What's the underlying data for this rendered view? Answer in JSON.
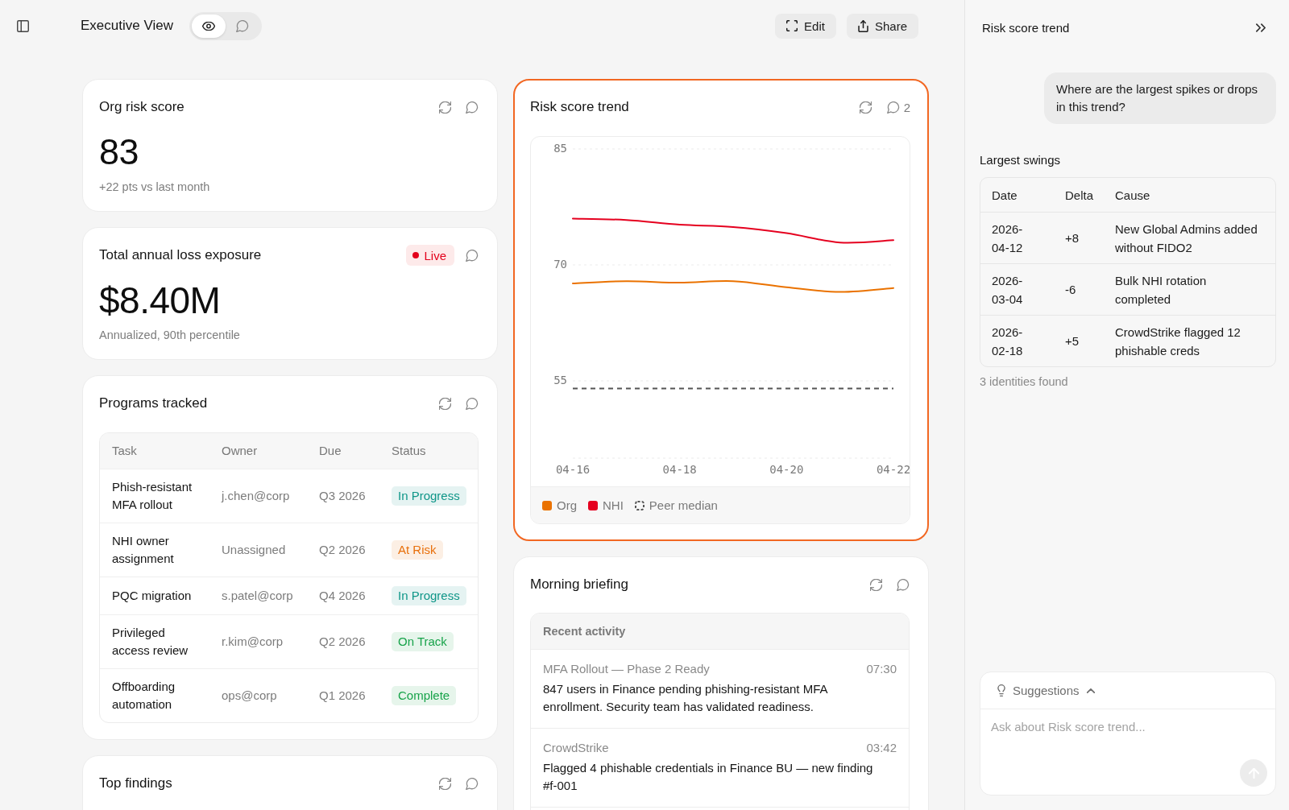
{
  "top_bar": {
    "title": "Executive View",
    "view_modes": [
      {
        "kind": "view",
        "selected": true
      },
      {
        "kind": "comment",
        "selected": false
      }
    ],
    "buttons": [
      {
        "kind": "edit",
        "label": "Edit"
      },
      {
        "kind": "share",
        "label": "Share"
      }
    ]
  },
  "org_risk_score": {
    "title": "Org risk score",
    "selected": false,
    "actions": [
      {
        "kind": "refresh"
      },
      {
        "kind": "comment"
      }
    ],
    "value": "83",
    "note": "+22 pts vs last month"
  },
  "loss_exposure": {
    "title": "Total annual loss exposure",
    "selected": false,
    "actions": [
      {
        "kind": "live",
        "label": "Live"
      },
      {
        "kind": "comment"
      }
    ],
    "value": "$8.40M",
    "note": "Annualized, 90th percentile"
  },
  "programs": {
    "title": "Programs tracked",
    "selected": false,
    "actions": [
      {
        "kind": "refresh"
      },
      {
        "kind": "comment"
      }
    ],
    "columns": [
      "Task",
      "Owner",
      "Due",
      "Status"
    ],
    "rows": [
      {
        "task": "Phish-resistant MFA rollout",
        "owner": "j.chen@corp",
        "due": "Q3 2026",
        "status": "In Progress",
        "color": "#0f9688"
      },
      {
        "task": "NHI owner assignment",
        "owner": "Unassigned",
        "due": "Q2 2026",
        "status": "At Risk",
        "color": "#e8700c"
      },
      {
        "task": "PQC migration",
        "owner": "s.patel@corp",
        "due": "Q4 2026",
        "status": "In Progress",
        "color": "#0f9688"
      },
      {
        "task": "Privileged access review",
        "owner": "r.kim@corp",
        "due": "Q2 2026",
        "status": "On Track",
        "color": "#17a34a"
      },
      {
        "task": "Offboarding automation",
        "owner": "ops@corp",
        "due": "Q1 2026",
        "status": "Complete",
        "color": "#17a34a"
      }
    ]
  },
  "top_findings": {
    "title": "Top findings",
    "selected": false,
    "actions": [
      {
        "kind": "refresh"
      },
      {
        "kind": "comment"
      }
    ]
  },
  "risk_trend": {
    "title": "Risk score trend",
    "selected": true,
    "actions": [
      {
        "kind": "refresh"
      },
      {
        "kind": "comment",
        "count": "2"
      }
    ],
    "chart_data": {
      "type": "line",
      "categories": [
        "04-16",
        null,
        "04-18",
        null,
        "04-20",
        null,
        "04-22"
      ],
      "ylim": [
        45,
        85
      ],
      "yticks": [
        55,
        70,
        85
      ],
      "series": [
        {
          "name": "Org",
          "color": "#ea7200",
          "values": [
            67.6,
            67.9,
            67.7,
            67.9,
            67.1,
            66.5,
            67.0
          ]
        },
        {
          "name": "NHI",
          "color": "#e5001f",
          "values": [
            76.0,
            75.8,
            75.2,
            74.9,
            74.1,
            72.9,
            73.2
          ]
        }
      ],
      "ref_lines": [
        {
          "axis": "y",
          "value": 54,
          "label": "Peer median",
          "color": "#555555"
        }
      ],
      "legend": "bottom"
    }
  },
  "morning_briefing": {
    "title": "Morning briefing",
    "selected": false,
    "actions": [
      {
        "kind": "refresh"
      },
      {
        "kind": "comment"
      }
    ],
    "section": "Recent activity",
    "items": [
      {
        "source": "MFA Rollout — Phase 2 Ready",
        "time": "07:30",
        "text": "847 users in Finance pending phishing-resistant MFA enrollment. Security team has validated readiness."
      },
      {
        "source": "CrowdStrike",
        "time": "03:42",
        "text": "Flagged 4 phishable credentials in Finance BU — new finding #f-001"
      }
    ]
  },
  "assistant_panel": {
    "title": "Risk score trend",
    "messages": [
      {
        "text": "Where are the largest spikes or drops in this trend?"
      }
    ],
    "answer": {
      "heading": "Largest swings",
      "columns": [
        "Date",
        "Delta",
        "Cause"
      ],
      "rows": [
        {
          "date": "2026-04-12",
          "delta": "+8",
          "cause": "New Global Admins added without FIDO2"
        },
        {
          "date": "2026-03-04",
          "delta": "-6",
          "cause": "Bulk NHI rotation completed"
        },
        {
          "date": "2026-02-18",
          "delta": "+5",
          "cause": "CrowdStrike flagged 12 phishable creds"
        }
      ],
      "footer": "3 identities found"
    },
    "suggestions": {
      "label": "Suggestions",
      "expanded": true
    },
    "input": {
      "placeholder": "Ask about Risk score trend..."
    },
    "send_button": {
      "disabled": true
    }
  }
}
